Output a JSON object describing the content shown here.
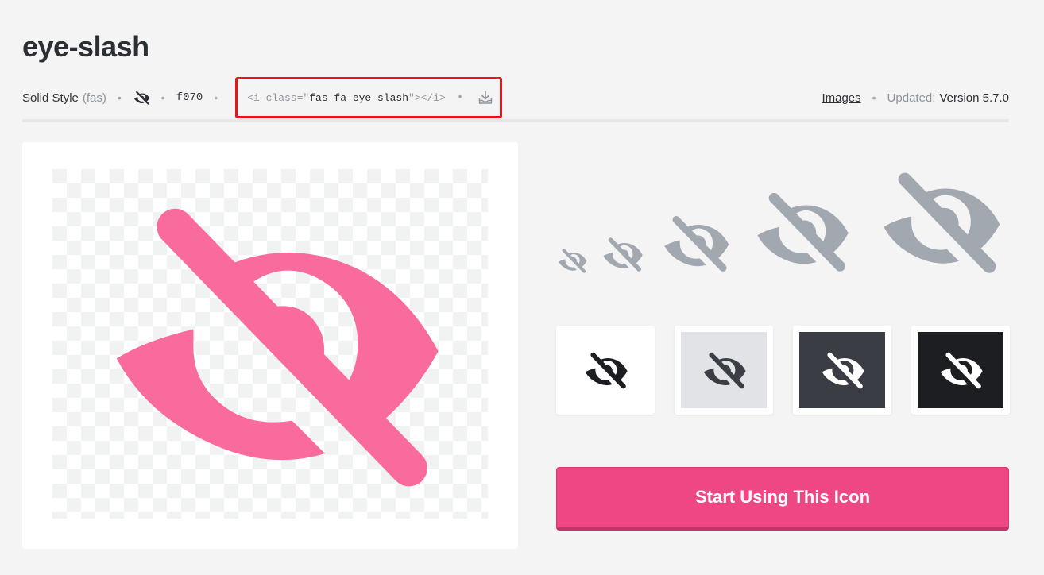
{
  "icon": {
    "name": "eye-slash",
    "unicode": "f070"
  },
  "meta": {
    "style_label": "Solid Style",
    "style_prefix": "(fas)",
    "separator": "•",
    "code_open": "<i class=\"",
    "code_class": "fas fa-eye-slash",
    "code_close": "\"></i>",
    "images_link": "Images",
    "updated_label": "Updated:",
    "version": "Version 5.7.0"
  },
  "preview": {
    "icon_color": "#f96b9c",
    "checker_color": "#f1f2f2"
  },
  "sizes": {
    "icon_color": "#a2a8b0"
  },
  "swatches": [
    {
      "name": "white",
      "background": "#ffffff",
      "icon_color": "#1c1e21"
    },
    {
      "name": "light-gray",
      "background": "#e1e3e6",
      "icon_color": "#3b3e44"
    },
    {
      "name": "dark-gray",
      "background": "#3a3d43",
      "icon_color": "#ffffff"
    },
    {
      "name": "black",
      "background": "#1c1e21",
      "icon_color": "#ffffff"
    }
  ],
  "cta": {
    "label": "Start Using This Icon",
    "color": "#ef4784"
  }
}
